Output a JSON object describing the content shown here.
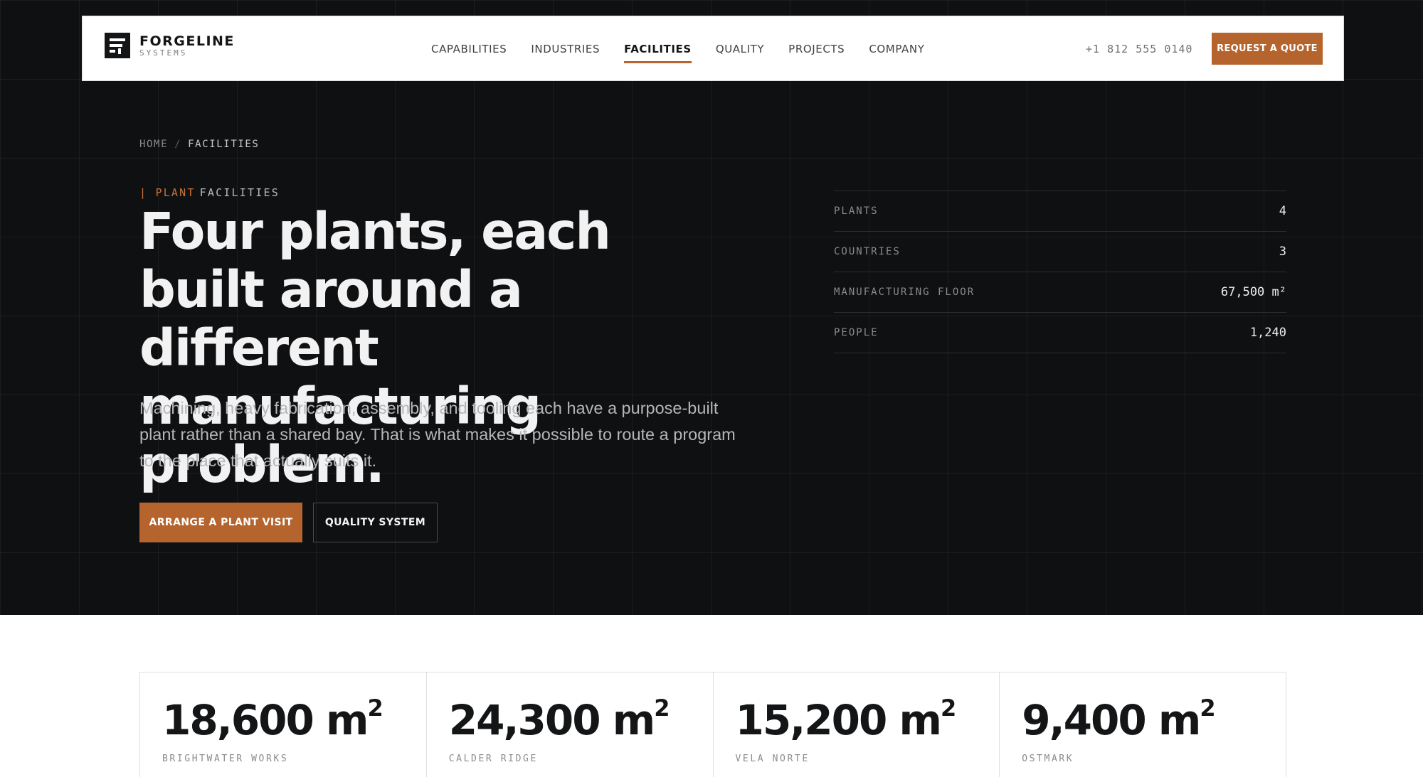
{
  "header": {
    "logo_name": "FORGELINE",
    "logo_sub": "SYSTEMS",
    "nav": [
      {
        "label": "CAPABILITIES",
        "active": false
      },
      {
        "label": "INDUSTRIES",
        "active": false
      },
      {
        "label": "FACILITIES",
        "active": true
      },
      {
        "label": "QUALITY",
        "active": false
      },
      {
        "label": "PROJECTS",
        "active": false
      },
      {
        "label": "COMPANY",
        "active": false
      }
    ],
    "phone": "+1 812 555 0140",
    "cta": "REQUEST A QUOTE"
  },
  "hero": {
    "breadcrumb": {
      "home": "HOME",
      "separator": "/",
      "current": "FACILITIES"
    },
    "eyebrow": {
      "bar": "|",
      "accent": "PLANT",
      "rest": "FACILITIES"
    },
    "headline": "Four plants, each built around a different manufacturing problem.",
    "lede": "Machining, heavy fabrication, assembly, and tooling each have a purpose-built plant rather than a shared bay. That is what makes it possible to route a program to the place that actually suits it.",
    "primary_button": "ARRANGE A PLANT VISIT",
    "secondary_button": "QUALITY SYSTEM"
  },
  "stats": [
    {
      "label": "PLANTS",
      "value": "4"
    },
    {
      "label": "COUNTRIES",
      "value": "3"
    },
    {
      "label": "MANUFACTURING FLOOR",
      "value": "67,500 m²"
    },
    {
      "label": "PEOPLE",
      "value": "1,240"
    }
  ],
  "plants": [
    {
      "area": "18,600 m",
      "unit_sup": "2",
      "name": "BRIGHTWATER WORKS"
    },
    {
      "area": "24,300 m",
      "unit_sup": "2",
      "name": "CALDER RIDGE"
    },
    {
      "area": "15,200 m",
      "unit_sup": "2",
      "name": "VELA NORTE"
    },
    {
      "area": "9,400 m",
      "unit_sup": "2",
      "name": "OSTMARK"
    }
  ],
  "colors": {
    "accent": "#b5642e",
    "hero_bg": "#0f1012",
    "page_bg": "#ffffff"
  }
}
